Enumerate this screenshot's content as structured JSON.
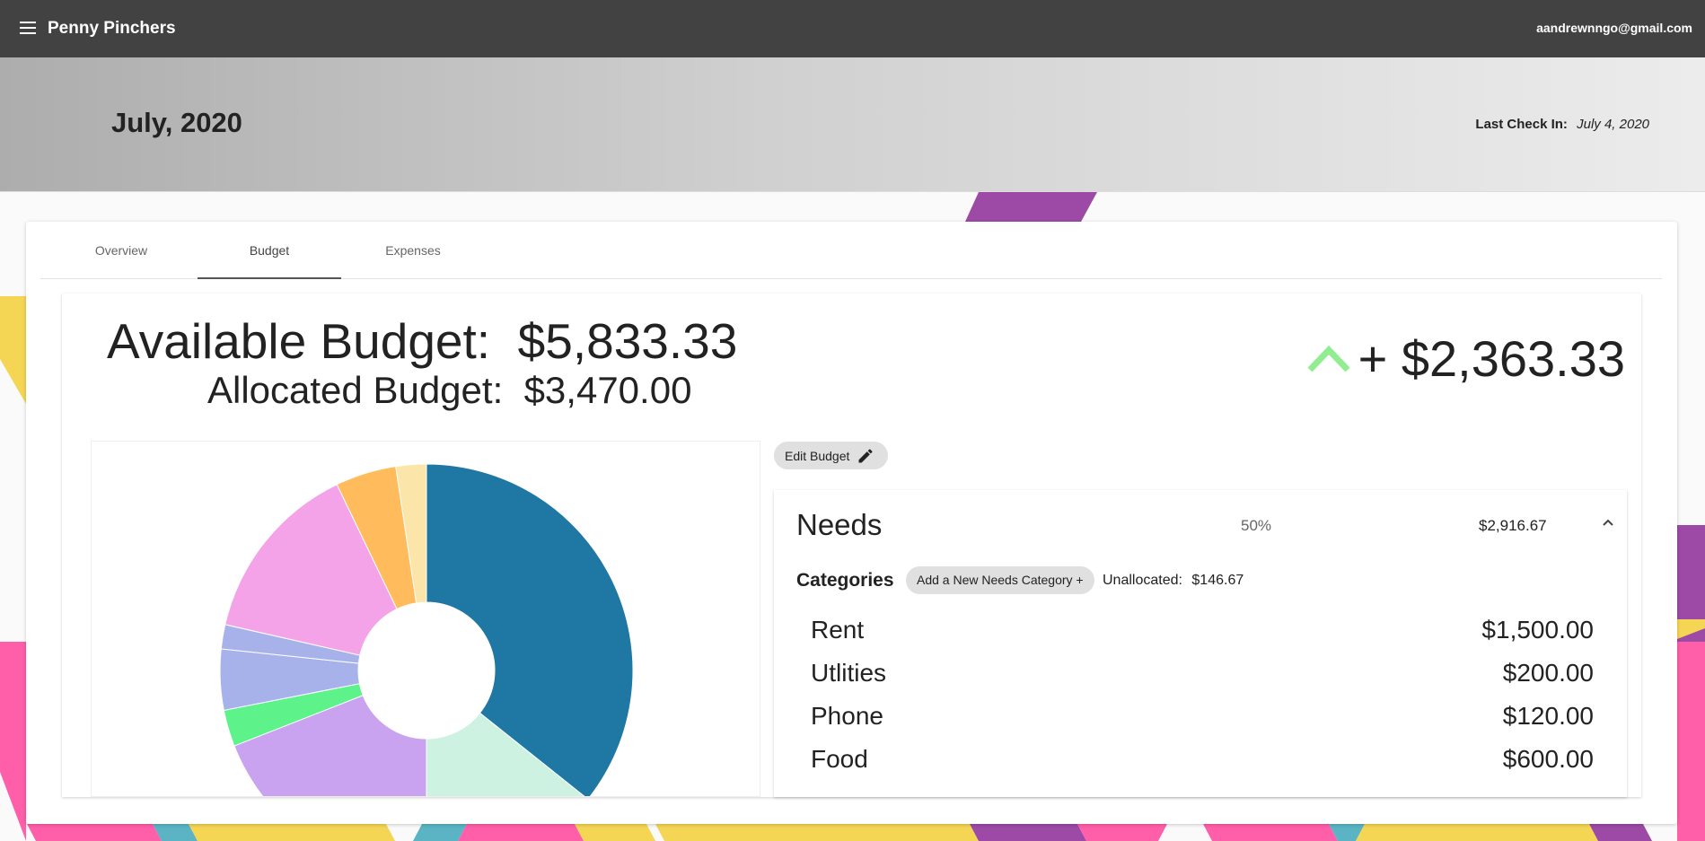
{
  "app": {
    "title": "Penny Pinchers",
    "user_email": "aandrewnngo@gmail.com",
    "menu_icon": "hamburger-menu-icon"
  },
  "banner": {
    "month": "July, 2020",
    "last_check_in_label": "Last Check In:",
    "last_check_in_value": "July 4, 2020"
  },
  "tabs": [
    {
      "label": "Overview",
      "active": false
    },
    {
      "label": "Budget",
      "active": true
    },
    {
      "label": "Expenses",
      "active": false
    }
  ],
  "budget": {
    "available_label": "Available Budget:",
    "available_value": "$5,833.33",
    "allocated_label": "Allocated Budget:",
    "allocated_value": "$3,470.00",
    "difference": "+ $2,363.33",
    "difference_icon": "chevron-up-icon",
    "difference_color": "#90ee90"
  },
  "edit_button": {
    "label": "Edit Budget",
    "icon": "pencil-icon"
  },
  "needs": {
    "title": "Needs",
    "percent": "50%",
    "amount": "$2,916.67",
    "categories_label": "Categories",
    "add_category_label": "Add a New Needs Category +",
    "unallocated_label": "Unallocated:",
    "unallocated_value": "$146.67",
    "items": [
      {
        "name": "Rent",
        "amount": "$1,500.00"
      },
      {
        "name": "Utlities",
        "amount": "$200.00"
      },
      {
        "name": "Phone",
        "amount": "$120.00"
      },
      {
        "name": "Food",
        "amount": "$600.00"
      }
    ]
  },
  "chart_data": {
    "type": "pie",
    "donut": true,
    "values": [
      1500,
      600,
      800,
      120,
      200,
      80,
      600,
      200,
      100
    ],
    "colors": [
      "#1f77a4",
      "#cef2e2",
      "#c9a3f0",
      "#5ef28a",
      "#a7b2ea",
      "#a7b2ea",
      "#f4a3e8",
      "#ffbb5c",
      "#fce5a8"
    ]
  }
}
